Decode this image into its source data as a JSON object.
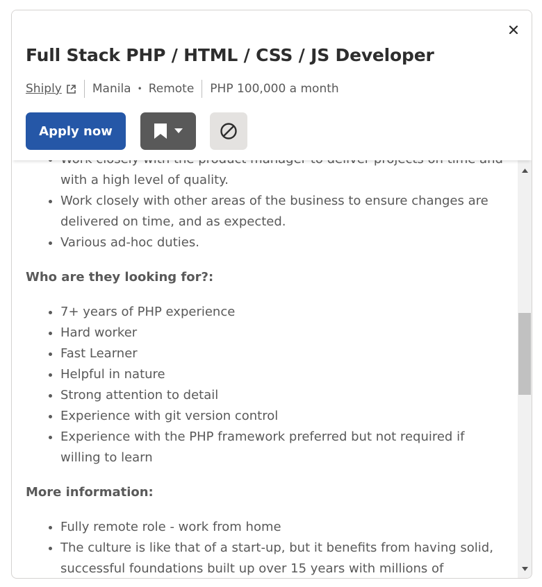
{
  "job": {
    "title": "Full Stack PHP / HTML / CSS / JS Developer",
    "company": "Shiply",
    "location": "Manila",
    "work_type": "Remote",
    "salary": "PHP 100,000 a month"
  },
  "actions": {
    "apply_label": "Apply now"
  },
  "description": {
    "partial_line": "Work closely with the product manager to deliver projects on time and with a high level of quality.",
    "duties": [
      "Work closely with other areas of the business to ensure changes are delivered on time, and as expected.",
      "Various ad-hoc duties."
    ],
    "looking_for_heading": "Who are they looking for?:",
    "looking_for": [
      "7+ years of PHP experience",
      "Hard worker",
      "Fast Learner",
      "Helpful in nature",
      "Strong attention to detail",
      "Experience with git version control",
      "Experience with the PHP framework preferred but not required if willing to learn"
    ],
    "more_info_heading": "More information:",
    "more_info": [
      "Fully remote role - work from home",
      "The culture is like that of a start-up, but it benefits from having solid, successful foundations built up over 15 years with millions of"
    ]
  },
  "icons": {
    "close": "close-icon",
    "external_link": "external-link-icon",
    "bookmark": "bookmark-icon",
    "not_interested": "not-interested-icon"
  },
  "colors": {
    "apply_button": "#2557a7",
    "save_button": "#595959",
    "not_interested_button": "#e4e2e0"
  }
}
